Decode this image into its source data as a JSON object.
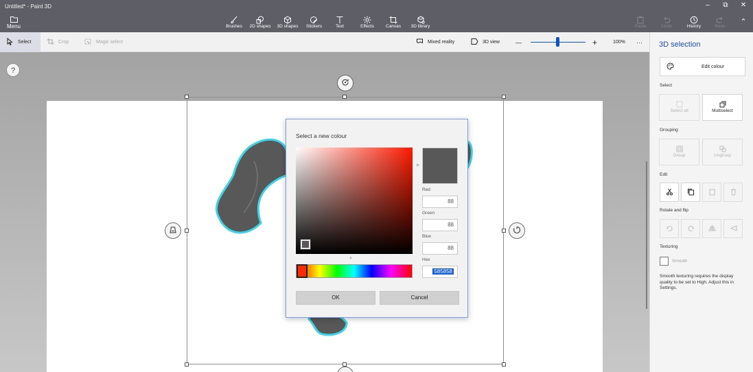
{
  "window": {
    "title": "Untitled* - Paint 3D",
    "minimize_glyph": "–",
    "maximize_glyph": "⧉",
    "close_glyph": "✕"
  },
  "ribbon": {
    "menu_label": "Menu",
    "tools": [
      {
        "label": "Brushes",
        "icon": "brush-icon"
      },
      {
        "label": "2D shapes",
        "icon": "2d-shapes-icon"
      },
      {
        "label": "3D shapes",
        "icon": "3d-shapes-icon"
      },
      {
        "label": "Stickers",
        "icon": "sticker-icon"
      },
      {
        "label": "Text",
        "icon": "text-icon"
      },
      {
        "label": "Effects",
        "icon": "effects-icon"
      },
      {
        "label": "Canvas",
        "icon": "canvas-icon"
      },
      {
        "label": "3D library",
        "icon": "3d-library-icon"
      }
    ],
    "right_tools": [
      {
        "label": "Paste",
        "icon": "paste-icon",
        "enabled": false
      },
      {
        "label": "Undo",
        "icon": "undo-icon",
        "enabled": false
      },
      {
        "label": "History",
        "icon": "history-icon",
        "enabled": true
      },
      {
        "label": "Redo",
        "icon": "redo-icon",
        "enabled": false
      }
    ],
    "collapse_glyph": "⌃"
  },
  "toolbar": {
    "select_label": "Select",
    "crop_label": "Crop",
    "magic_select_label": "Magic select",
    "mixed_reality_label": "Mixed reality",
    "view_3d_label": "3D view",
    "zoom_out_glyph": "—",
    "zoom_in_glyph": "+",
    "zoom_level": "100%",
    "more_glyph": "···",
    "zoom_fraction": 0.5
  },
  "workspace": {
    "help_glyph": "?"
  },
  "colour_dialog": {
    "title": "Select a new colour",
    "red_label": "Red",
    "red_value": "88",
    "green_label": "Green",
    "green_value": "88",
    "blue_label": "Blue",
    "blue_value": "88",
    "hex_label": "Hex",
    "hex_value": "585858",
    "ok_label": "OK",
    "cancel_label": "Cancel",
    "preview_color": "#585858",
    "hue_color": "#ff2a00"
  },
  "panel": {
    "title": "3D selection",
    "edit_colour_label": "Edit colour",
    "select_section": "Select",
    "select_all_label": "Select all",
    "multiselect_label": "Multiselect",
    "grouping_section": "Grouping",
    "group_label": "Group",
    "ungroup_label": "Ungroup",
    "edit_section": "Edit",
    "rotate_section": "Rotate and flip",
    "texturing_section": "Texturing",
    "smooth_label": "Smooth",
    "smooth_note": "Smooth texturing requires the display quality to be set to High. Adjust this in Settings."
  },
  "colors": {
    "accent": "#1a4fb0",
    "object_outline": "#3ad5e8",
    "object_fill": "#595859"
  }
}
